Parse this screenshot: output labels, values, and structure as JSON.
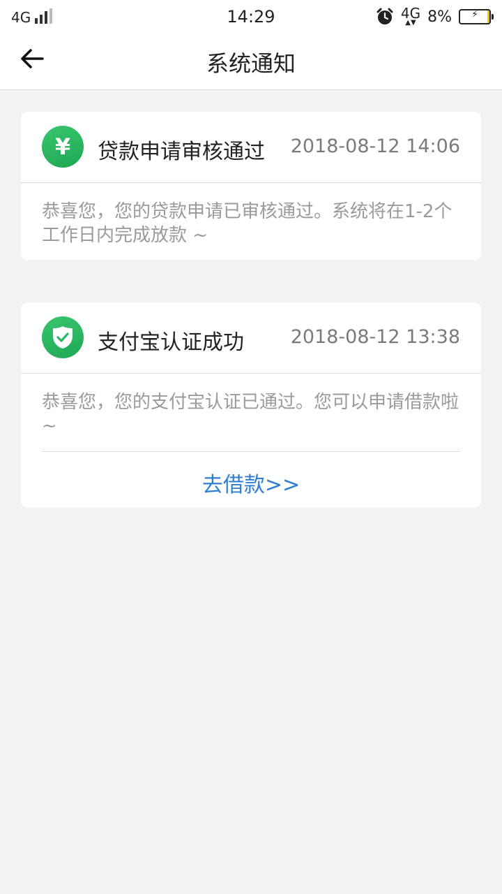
{
  "status_bar": {
    "network": "4G",
    "time": "14:29",
    "network_right": "4G",
    "battery_percent": "8%",
    "battery_level": 0.08,
    "charging": true
  },
  "nav": {
    "title": "系统通知",
    "back_icon": "arrow-left-icon"
  },
  "notifications": [
    {
      "icon": "yen-icon",
      "icon_glyph": "¥",
      "title": "贷款申请审核通过",
      "time": "2018-08-12 14:06",
      "body": "恭喜您，您的贷款申请已审核通过。系统将在1-2个工作日内完成放款 ~"
    },
    {
      "icon": "shield-check-icon",
      "title": "支付宝认证成功",
      "time": "2018-08-12 13:38",
      "body": "恭喜您，您的支付宝认证已通过。您可以申请借款啦 ~",
      "action_label": "去借款>>"
    }
  ],
  "colors": {
    "accent_green": "#2bb763",
    "link_blue": "#2e7fd1",
    "background": "#f2f2f2"
  }
}
